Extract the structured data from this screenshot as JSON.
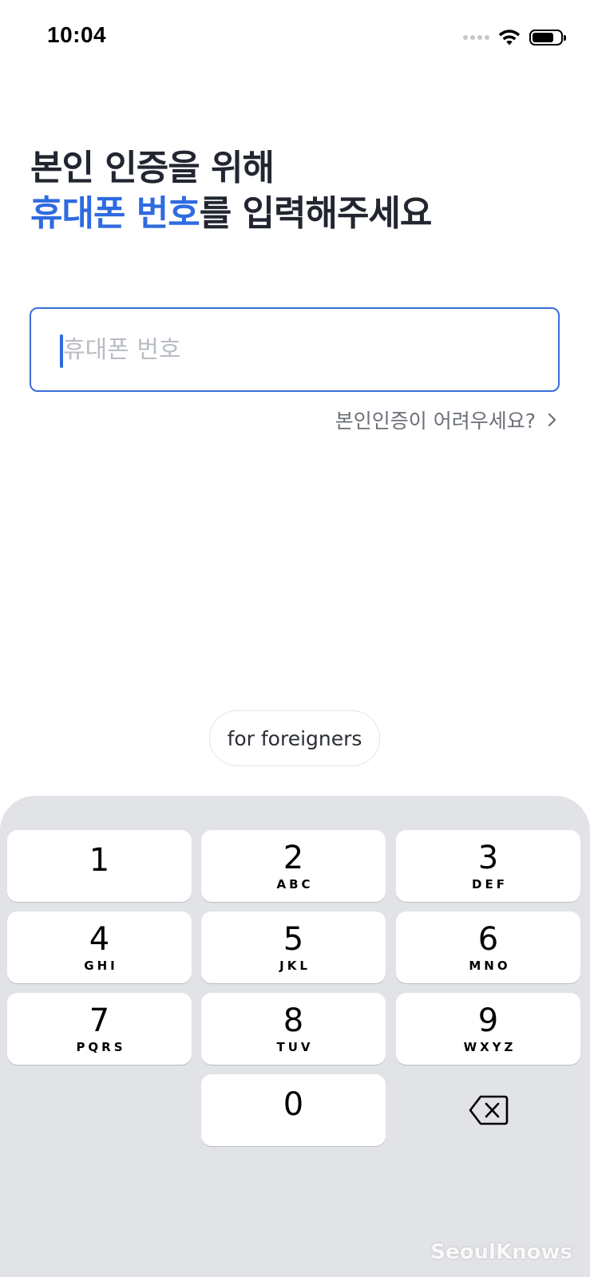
{
  "status_bar": {
    "time": "10:04",
    "icons": [
      "cellular-icon",
      "wifi-icon",
      "battery-icon"
    ]
  },
  "headline": {
    "line1": "본인 인증을 위해",
    "line2_accent": "휴대폰 번호",
    "line2_rest": "를 입력해주세요",
    "accent_color": "#2f6be0"
  },
  "phone_input": {
    "value": "",
    "placeholder": "휴대폰 번호",
    "border_color": "#3a6fd8"
  },
  "help_link": {
    "label": "본인인증이 어려우세요?"
  },
  "foreigners_button": {
    "label": "for foreigners"
  },
  "keypad": {
    "keys": [
      {
        "digit": "1",
        "letters": ""
      },
      {
        "digit": "2",
        "letters": "ABC"
      },
      {
        "digit": "3",
        "letters": "DEF"
      },
      {
        "digit": "4",
        "letters": "GHI"
      },
      {
        "digit": "5",
        "letters": "JKL"
      },
      {
        "digit": "6",
        "letters": "MNO"
      },
      {
        "digit": "7",
        "letters": "PQRS"
      },
      {
        "digit": "8",
        "letters": "TUV"
      },
      {
        "digit": "9",
        "letters": "WXYZ"
      },
      {
        "digit": "0",
        "letters": ""
      }
    ],
    "delete_icon": "delete-backspace-icon"
  },
  "watermark": {
    "text": "SeoulKnows"
  }
}
